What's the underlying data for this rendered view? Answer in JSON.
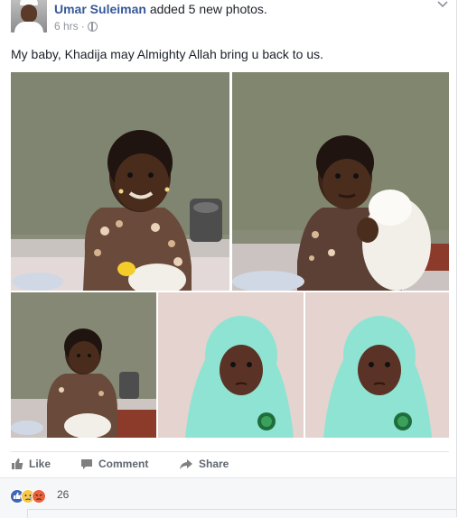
{
  "post": {
    "author": "Umar Suleiman",
    "action": "added 5 new photos.",
    "time": "6 hrs",
    "time_separator": "·",
    "text": "My baby, Khadija may Almighty Allah bring u back to us."
  },
  "actions": {
    "like_label": "Like",
    "comment_label": "Comment",
    "share_label": "Share"
  },
  "reactions": {
    "icons": [
      "like-icon",
      "sad-icon",
      "angry-icon"
    ],
    "count": "26"
  },
  "colors": {
    "link": "#365899",
    "meta": "#90949c",
    "action_text": "#616770",
    "like_blue": "#4267b2",
    "hijab": "#8fe3d3"
  }
}
